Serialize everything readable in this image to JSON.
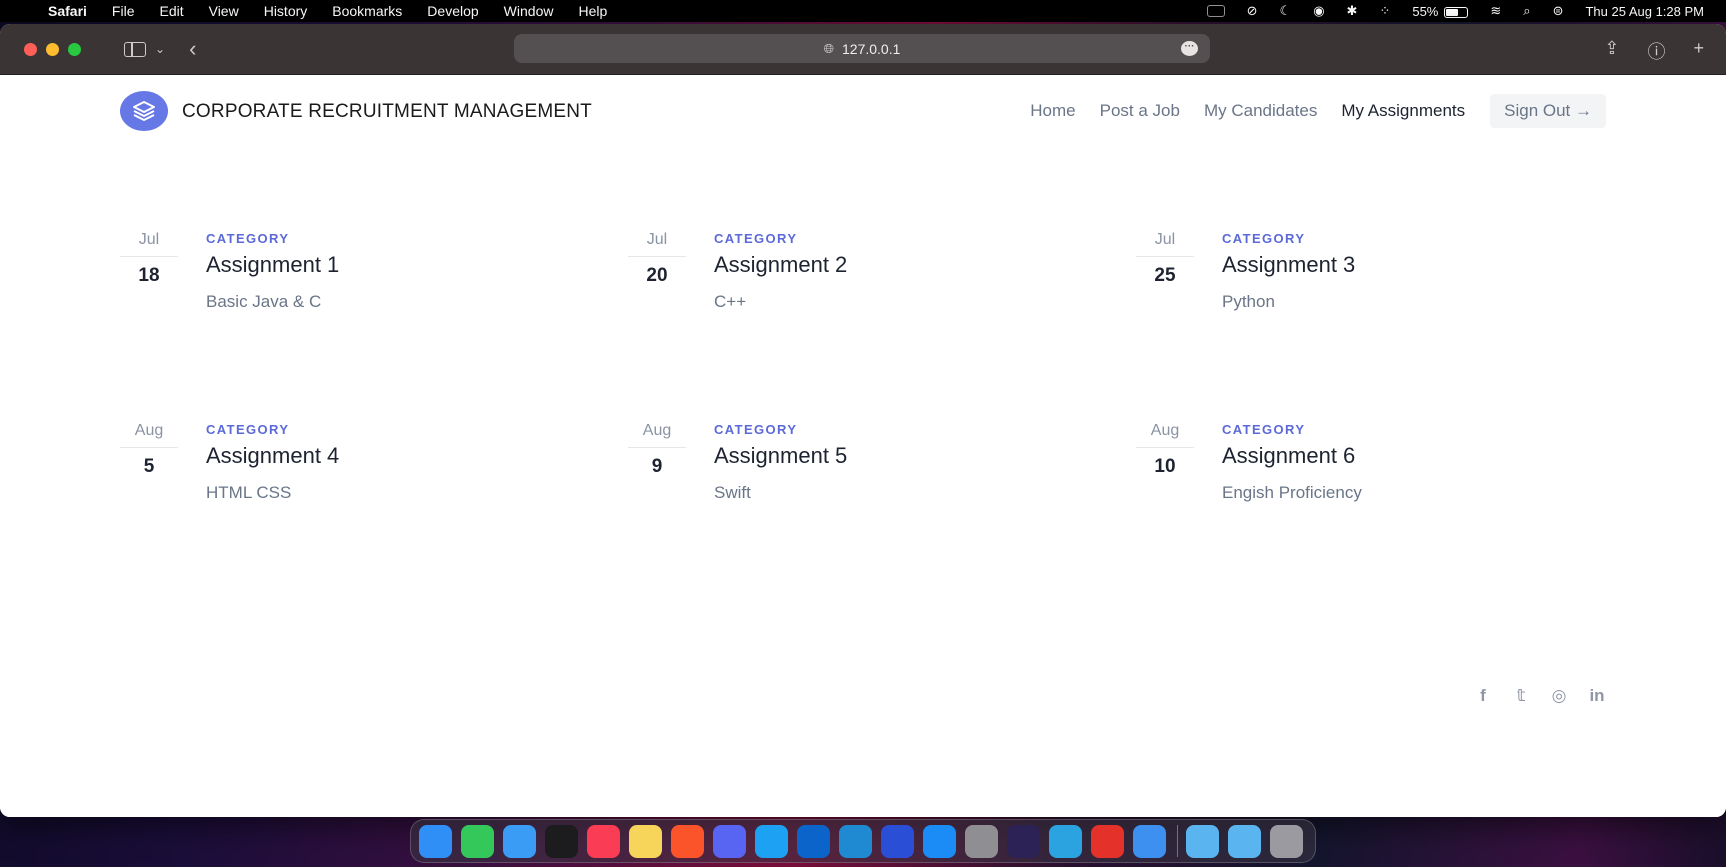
{
  "menubar": {
    "apple": "",
    "app": "Safari",
    "menus": [
      "File",
      "Edit",
      "View",
      "History",
      "Bookmarks",
      "Develop",
      "Window",
      "Help"
    ],
    "battery": "55%",
    "datetime": "Thu 25 Aug  1:28 PM"
  },
  "browser": {
    "url": "127.0.0.1"
  },
  "site": {
    "title": "CORPORATE RECRUITMENT MANAGEMENT",
    "nav": {
      "home": "Home",
      "post_job": "Post a Job",
      "candidates": "My Candidates",
      "assignments": "My Assignments",
      "signout": "Sign Out →"
    }
  },
  "assignments": [
    {
      "month": "Jul",
      "day": "18",
      "category": "CATEGORY",
      "title": "Assignment 1",
      "desc": "Basic Java & C"
    },
    {
      "month": "Jul",
      "day": "20",
      "category": "CATEGORY",
      "title": "Assignment 2",
      "desc": "C++"
    },
    {
      "month": "Jul",
      "day": "25",
      "category": "CATEGORY",
      "title": "Assignment 3",
      "desc": "Python"
    },
    {
      "month": "Aug",
      "day": "5",
      "category": "CATEGORY",
      "title": "Assignment 4",
      "desc": "HTML CSS"
    },
    {
      "month": "Aug",
      "day": "9",
      "category": "CATEGORY",
      "title": "Assignment 5",
      "desc": "Swift"
    },
    {
      "month": "Aug",
      "day": "10",
      "category": "CATEGORY",
      "title": "Assignment 6",
      "desc": "Engish Proficiency"
    }
  ],
  "social": {
    "facebook": "f",
    "twitter": "𝕥",
    "instagram": "◎",
    "linkedin": "in"
  },
  "dock_apps": [
    {
      "name": "finder-icon",
      "color": "#2f8ff7"
    },
    {
      "name": "messages-icon",
      "color": "#34c759"
    },
    {
      "name": "mail-icon",
      "color": "#3b9cf5"
    },
    {
      "name": "tv-icon",
      "color": "#1c1c1e"
    },
    {
      "name": "music-icon",
      "color": "#fa3c55"
    },
    {
      "name": "notes-icon",
      "color": "#f7d55a"
    },
    {
      "name": "brave-icon",
      "color": "#fb542b"
    },
    {
      "name": "discord-icon",
      "color": "#5865f2"
    },
    {
      "name": "twitter-app-icon",
      "color": "#1da1f2"
    },
    {
      "name": "outlook-icon",
      "color": "#0a64c9"
    },
    {
      "name": "vscode-icon",
      "color": "#1f8ad2"
    },
    {
      "name": "simulator-icon",
      "color": "#2a4fd6"
    },
    {
      "name": "appstore-icon",
      "color": "#1b8cf5"
    },
    {
      "name": "settings-icon",
      "color": "#8e8e93"
    },
    {
      "name": "eclipse-icon",
      "color": "#2c2255"
    },
    {
      "name": "telegram-icon",
      "color": "#2aa3e0"
    },
    {
      "name": "scrap-icon",
      "color": "#e4322b"
    },
    {
      "name": "safari-icon",
      "color": "#3d8ff0"
    },
    {
      "name": "folder-applications-icon",
      "color": "#5ab4ef"
    },
    {
      "name": "folder-downloads-icon",
      "color": "#5ab4ef"
    },
    {
      "name": "trash-icon",
      "color": "#9a9aa0"
    }
  ]
}
